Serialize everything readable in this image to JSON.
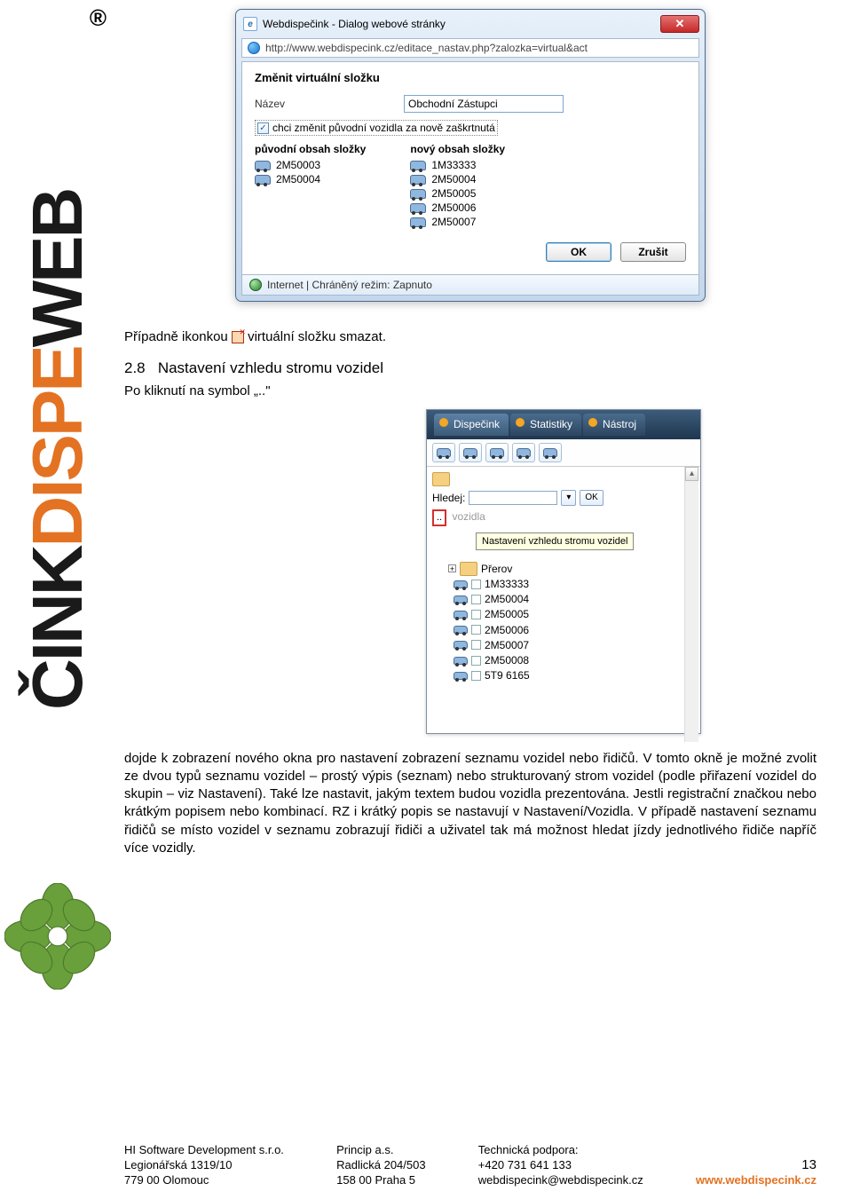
{
  "logo": {
    "word1": "WEB",
    "word2": "DISPE",
    "word3": "ČINK",
    "reg": "®"
  },
  "dialog": {
    "title": "Webdispečink - Dialog webové stránky",
    "url": "http://www.webdispecink.cz/editace_nastav.php?zalozka=virtual&act",
    "heading": "Změnit virtuální složku",
    "name_label": "Název",
    "name_value": "Obchodní Zástupci",
    "checkbox_label": "chci změnit původní vozidla za nově zaškrtnutá",
    "col1_head": "původní obsah složky",
    "col2_head": "nový obsah složky",
    "col1": [
      "2M50003",
      "2M50004"
    ],
    "col2": [
      "1M33333",
      "2M50004",
      "2M50005",
      "2M50006",
      "2M50007"
    ],
    "ok": "OK",
    "cancel": "Zrušit",
    "status": "Internet | Chráněný režim: Zapnuto"
  },
  "doc": {
    "del_before": "Případně ikonkou",
    "del_after": "virtuální složku smazat.",
    "sec_num": "2.8",
    "sec_title": "Nastavení vzhledu stromu vozidel",
    "sym_line": "Po kliknutí na symbol „..\"",
    "para": "dojde k zobrazení nového okna pro nastavení zobrazení seznamu vozidel nebo řidičů. V tomto okně je možné zvolit ze dvou typů seznamu vozidel – prostý výpis (seznam) nebo strukturovaný strom vozidel (podle přiřazení vozidel do skupin – viz Nastavení). Také lze nastavit, jakým textem budou vozidla prezentována. Jestli registrační značkou nebo krátkým popisem nebo kombinací. RZ i krátký popis se nastavují v Nastavení/Vozidla. V případě nastavení seznamu řidičů se místo vozidel v seznamu zobrazují řidiči a uživatel tak má možnost hledat jízdy jednotlivého řidiče napříč více vozidly."
  },
  "panel": {
    "tabs": [
      "Dispečink",
      "Statistiky",
      "Nástroj"
    ],
    "hledej": "Hledej:",
    "ok": "OK",
    "vozidla": "vozidla",
    "tooltip": "Nastavení vzhledu stromu vozidel",
    "folder": "Přerov",
    "items": [
      "1M33333",
      "2M50004",
      "2M50005",
      "2M50006",
      "2M50007",
      "2M50008",
      "5T9 6165"
    ]
  },
  "footer": {
    "c1": [
      "HI Software Development s.r.o.",
      "Legionářská 1319/10",
      "779 00 Olomouc"
    ],
    "c2": [
      "Princip a.s.",
      "Radlická 204/503",
      "158 00 Praha 5"
    ],
    "c3": [
      "Technická podpora:",
      "+420 731 641 133",
      "webdispecink@webdispecink.cz"
    ],
    "link": "www.webdispecink.cz",
    "page": "13"
  }
}
